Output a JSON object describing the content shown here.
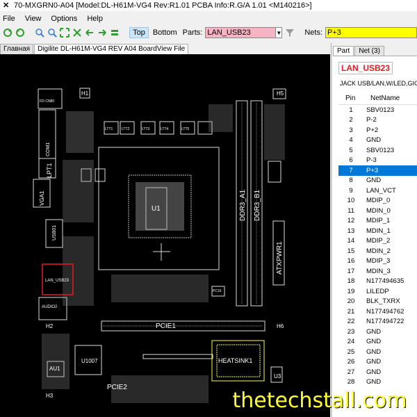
{
  "window": {
    "title": "70-MXGRN0-A04 [Model:DL-H61M-VG4 Rev:R1.01 PCBA Info:R.G/A 1.01   <M140216>]"
  },
  "menu": [
    "File",
    "View",
    "Options",
    "Help"
  ],
  "toolbar": {
    "top_label": "Top",
    "bottom_label": "Bottom",
    "parts_label": "Parts:",
    "parts_value": "LAN_USB23",
    "nets_label": "Nets:",
    "nets_value": "P+3"
  },
  "tabs": {
    "main": "Главная",
    "doc": "Digilite DL-H61M-VG4 REV A04 BoardView File"
  },
  "panel": {
    "tab_part": "Part",
    "tab_net": "Net (3)",
    "part_name": "LAN_USB23",
    "part_desc": "JACK USB/LAN,W/LED,GIG",
    "col_pin": "Pin",
    "col_net": "NetName",
    "rows": [
      {
        "pin": "1",
        "net": "SBV0123"
      },
      {
        "pin": "2",
        "net": "P-2"
      },
      {
        "pin": "3",
        "net": "P+2"
      },
      {
        "pin": "4",
        "net": "GND"
      },
      {
        "pin": "5",
        "net": "SBV0123"
      },
      {
        "pin": "6",
        "net": "P-3"
      },
      {
        "pin": "7",
        "net": "P+3"
      },
      {
        "pin": "8",
        "net": "GND"
      },
      {
        "pin": "9",
        "net": "LAN_VCT"
      },
      {
        "pin": "10",
        "net": "MDIP_0"
      },
      {
        "pin": "11",
        "net": "MDIN_0"
      },
      {
        "pin": "12",
        "net": "MDIP_1"
      },
      {
        "pin": "13",
        "net": "MDIN_1"
      },
      {
        "pin": "14",
        "net": "MDIP_2"
      },
      {
        "pin": "15",
        "net": "MDIN_2"
      },
      {
        "pin": "16",
        "net": "MDIP_3"
      },
      {
        "pin": "17",
        "net": "MDIN_3"
      },
      {
        "pin": "18",
        "net": "N177494635"
      },
      {
        "pin": "19",
        "net": "LILEDP"
      },
      {
        "pin": "20",
        "net": "BLK_TXRX"
      },
      {
        "pin": "21",
        "net": "N177494762"
      },
      {
        "pin": "22",
        "net": "N177494722"
      },
      {
        "pin": "23",
        "net": "GND"
      },
      {
        "pin": "24",
        "net": "GND"
      },
      {
        "pin": "25",
        "net": "GND"
      },
      {
        "pin": "26",
        "net": "GND"
      },
      {
        "pin": "27",
        "net": "GND"
      },
      {
        "pin": "28",
        "net": "GND"
      }
    ]
  },
  "board_labels": {
    "h1": "H1",
    "h5": "H5",
    "h2": "H2",
    "h6": "H6",
    "h3": "H3",
    "com1": "COM1",
    "lpt1": "LPT1",
    "vga1": "VGA1",
    "usb01": "USB01",
    "lan_usb23": "LAN_USB23",
    "audio": "AUDIO2",
    "u1": "U1",
    "ddr3a1": "DDR3_A1",
    "ddr3b1": "DDR3_B1",
    "atxpwr": "ATXPWR1",
    "pcie1": "PCIE1",
    "pcie2": "PCIE2",
    "u1007": "U1007",
    "au1": "AU1",
    "heatsink": "HEATSINK1",
    "u3": "U3",
    "pc16": "PC16",
    "fd_cn": "FD-CN80",
    "ltt1": "LTT1",
    "ltt2": "LTT2",
    "ltt3": "LTT3",
    "ltt4": "LTT4",
    "ltt5": "LTT5"
  },
  "watermark": "thetechstall.com",
  "colors": {
    "selection": "#0078d7",
    "parts_field": "#f4b4c4",
    "nets_field": "#ffff00",
    "part_name": "#e31b23",
    "highlight": "#e31b23"
  }
}
